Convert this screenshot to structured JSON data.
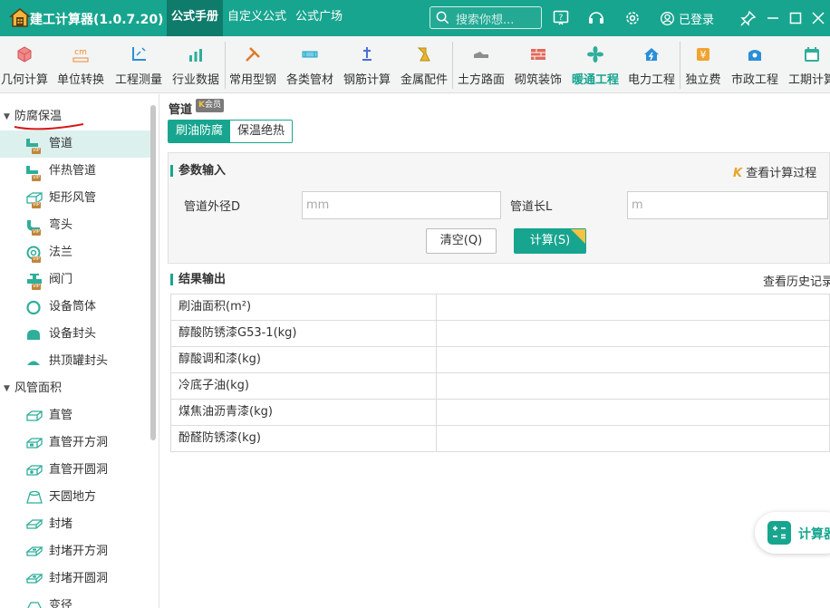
{
  "app": {
    "title": "建工计算器(1.0.7.20)",
    "accent_color": "#18a58f",
    "top_tabs": [
      {
        "label": "公式手册",
        "active": true
      },
      {
        "label": "自定义公式",
        "active": false
      },
      {
        "label": "公式广场",
        "active": false
      }
    ],
    "search_placeholder": "搜索你想...",
    "login_label": "已登录"
  },
  "ribbon": {
    "items": [
      {
        "label": "几何计算",
        "icon": "cube-icon"
      },
      {
        "label": "单位转换",
        "icon": "unit-cm-icon"
      },
      {
        "label": "工程测量",
        "icon": "measure-icon"
      },
      {
        "label": "行业数据",
        "icon": "bar-chart-icon"
      },
      {
        "label": "常用型钢",
        "icon": "steel-tools-icon"
      },
      {
        "label": "各类管材",
        "icon": "pipe-icon"
      },
      {
        "label": "钢筋计算",
        "icon": "rebar-icon"
      },
      {
        "label": "金属配件",
        "icon": "metal-fitting-icon"
      },
      {
        "label": "土方路面",
        "icon": "road-icon"
      },
      {
        "label": "砌筑装饰",
        "icon": "brick-icon"
      },
      {
        "label": "暖通工程",
        "icon": "fan-icon",
        "active": true
      },
      {
        "label": "电力工程",
        "icon": "power-house-icon"
      },
      {
        "label": "独立费",
        "icon": "money-icon"
      },
      {
        "label": "市政工程",
        "icon": "municipal-icon"
      },
      {
        "label": "工期计算",
        "icon": "calendar-icon"
      }
    ]
  },
  "sidebar": {
    "groups": [
      {
        "label": "防腐保温",
        "items": [
          {
            "label": "管道",
            "active": true,
            "vip": "VIP"
          },
          {
            "label": "伴热管道",
            "vip": "VIP"
          },
          {
            "label": "矩形风管",
            "vip": "VIP"
          },
          {
            "label": "弯头",
            "vip": "VIP"
          },
          {
            "label": "法兰",
            "vip": "VIP"
          },
          {
            "label": "阀门",
            "vip": "VIP"
          },
          {
            "label": "设备筒体"
          },
          {
            "label": "设备封头"
          },
          {
            "label": "拱顶罐封头"
          }
        ]
      },
      {
        "label": "风管面积",
        "items": [
          {
            "label": "直管"
          },
          {
            "label": "直管开方洞"
          },
          {
            "label": "直管开圆洞"
          },
          {
            "label": "天圆地方"
          },
          {
            "label": "封堵"
          },
          {
            "label": "封堵开方洞"
          },
          {
            "label": "封堵开圆洞"
          },
          {
            "label": "变径"
          }
        ]
      }
    ]
  },
  "main": {
    "title": "管道",
    "badge": "会员",
    "tabs": [
      {
        "label": "刷油防腐",
        "active": true
      },
      {
        "label": "保温绝热",
        "active": false
      }
    ],
    "input_section": {
      "title": "参数输入",
      "view_process_label": "查看计算过程",
      "fields": [
        {
          "label": "管道外径D",
          "placeholder": "mm",
          "value": ""
        },
        {
          "label": "管道长L",
          "placeholder": "m",
          "value": ""
        }
      ],
      "clear_label": "清空(Q)",
      "calc_label": "计算(S)"
    },
    "output_section": {
      "title": "结果输出",
      "history_label": "查看历史记录",
      "rows": [
        {
          "label": "刷油面积(m²)",
          "value": ""
        },
        {
          "label": "醇酸防锈漆G53-1(kg)",
          "value": ""
        },
        {
          "label": "醇酸调和漆(kg)",
          "value": ""
        },
        {
          "label": "冷底子油(kg)",
          "value": ""
        },
        {
          "label": "煤焦油沥青漆(kg)",
          "value": ""
        },
        {
          "label": "酚醛防锈漆(kg)",
          "value": ""
        }
      ]
    }
  },
  "float_button": {
    "label": "计算器"
  }
}
